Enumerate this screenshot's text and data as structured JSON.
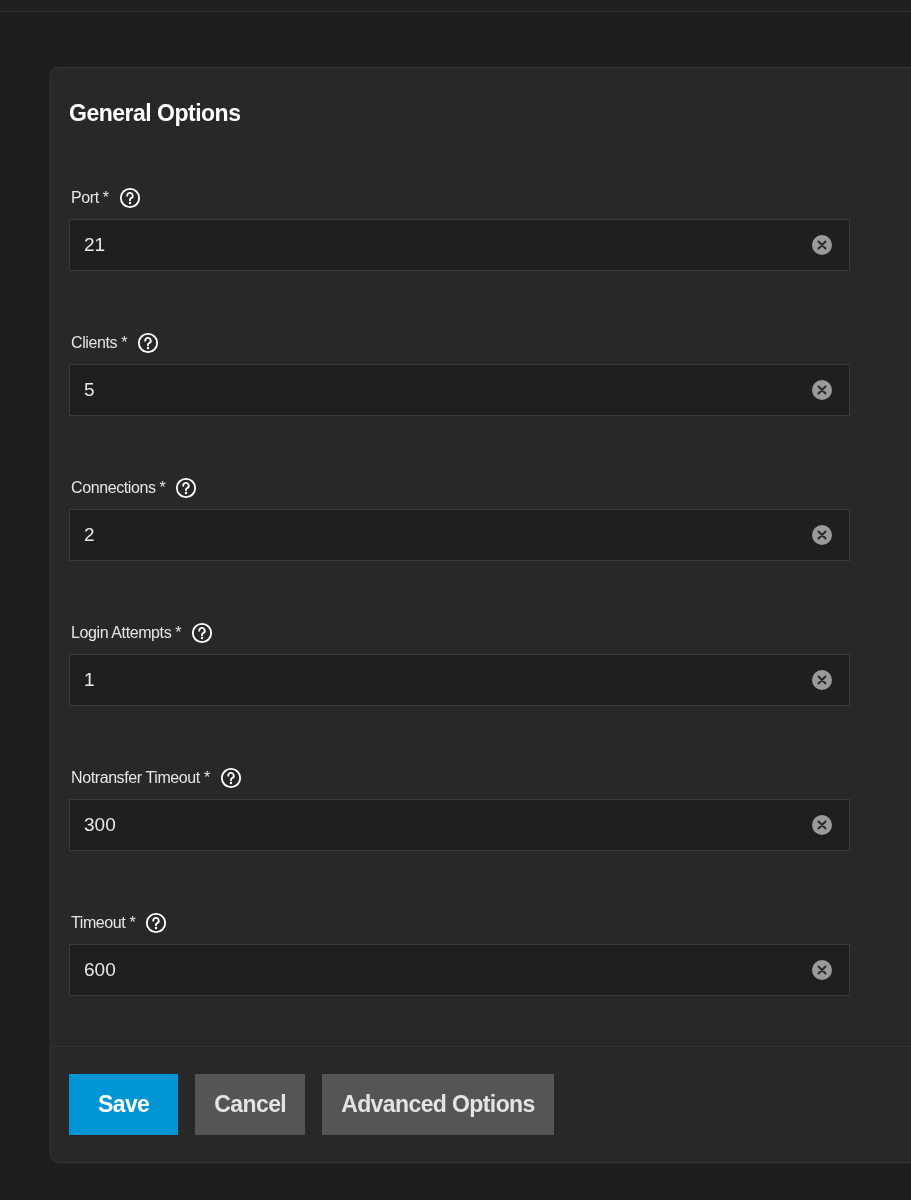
{
  "card": {
    "title": "General Options"
  },
  "fields": [
    {
      "label": "Port *",
      "value": "21"
    },
    {
      "label": "Clients *",
      "value": "5"
    },
    {
      "label": "Connections *",
      "value": "2"
    },
    {
      "label": "Login Attempts *",
      "value": "1"
    },
    {
      "label": "Notransfer Timeout *",
      "value": "300"
    },
    {
      "label": "Timeout *",
      "value": "600"
    }
  ],
  "buttons": [
    {
      "label": "Save",
      "kind": "primary"
    },
    {
      "label": "Cancel",
      "kind": "default"
    },
    {
      "label": "Advanced Options",
      "kind": "default"
    }
  ]
}
